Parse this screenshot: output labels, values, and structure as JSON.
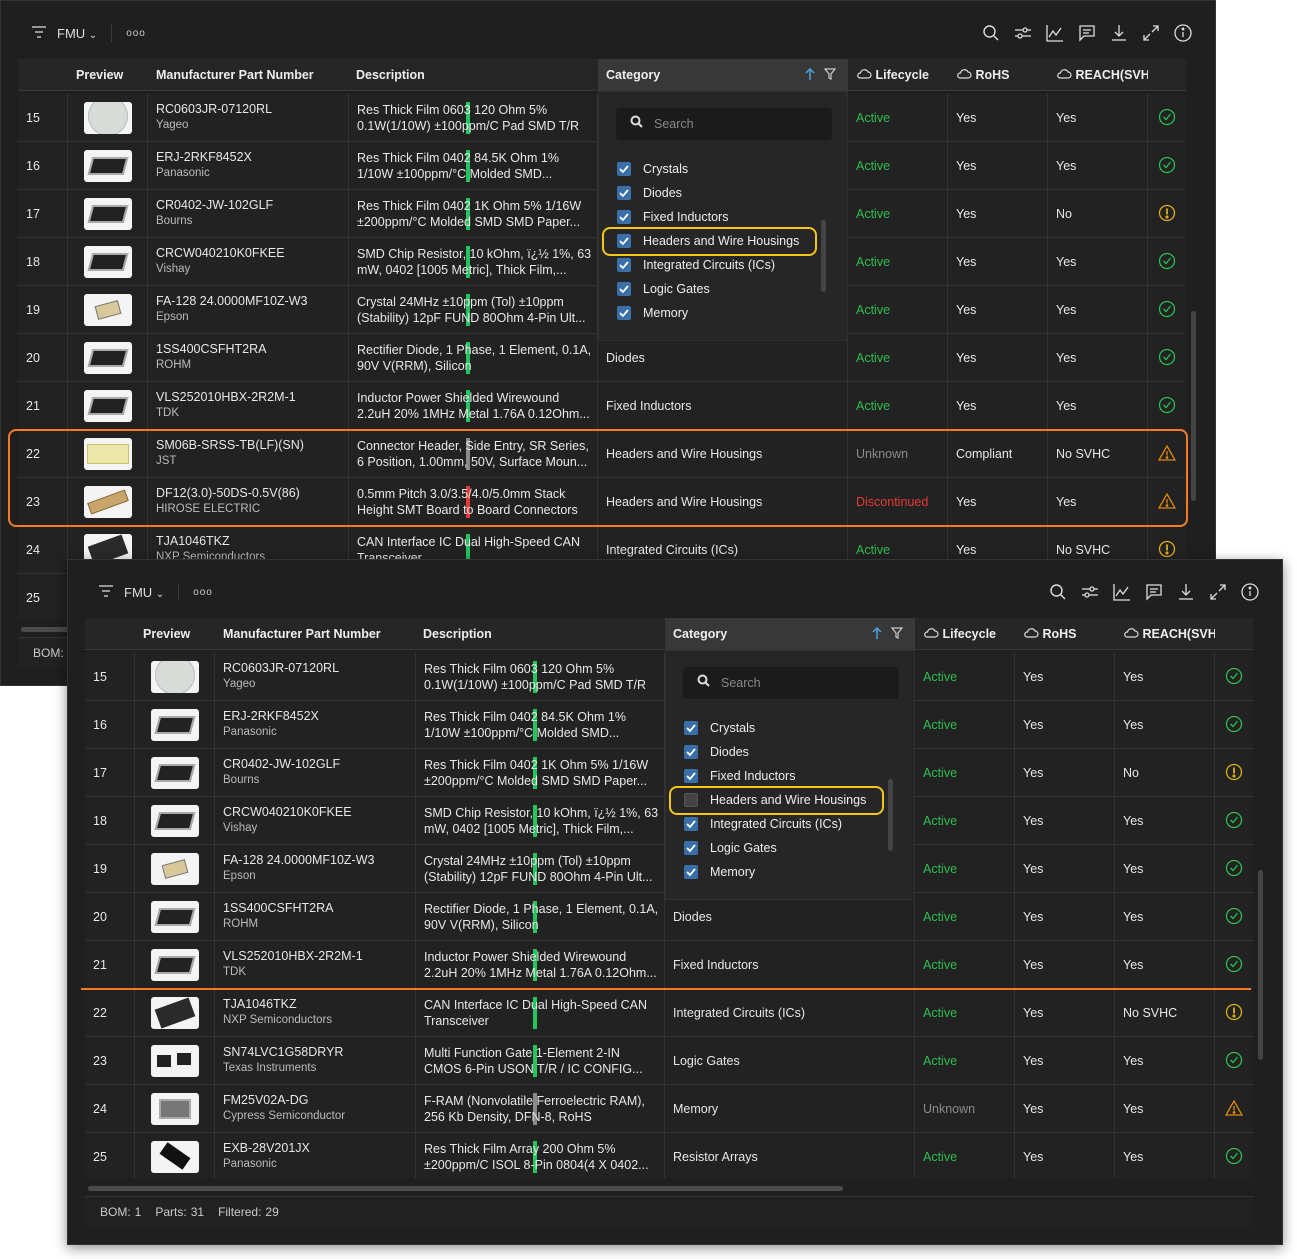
{
  "colors": {
    "active": "#2ebd4e",
    "unknown": "#8a8a8a",
    "discontinued": "#e53935",
    "stripe_green": "#22c55e",
    "stripe_gray": "#8a8a8a",
    "stripe_red": "#e53935",
    "highlight_yellow": "#f5c518",
    "highlight_orange": "#f47b20",
    "checkbox": "#3a6ea8"
  },
  "toolbar": {
    "menu_icon": "filter-lines-icon",
    "project": "FMU",
    "more_icon": "more-dots-icon",
    "more": "ooo",
    "right_icons": [
      "search-icon",
      "sliders-icon",
      "chart-icon",
      "comment-icon",
      "download-icon",
      "expand-icon",
      "info-icon"
    ]
  },
  "columns": {
    "preview": "Preview",
    "mpn": "Manufacturer Part Number",
    "description": "Description",
    "category": "Category",
    "lifecycle": "Lifecycle",
    "rohs": "RoHS",
    "reach": "REACH(SVH"
  },
  "filter": {
    "search_placeholder": "Search",
    "items": [
      "Crystals",
      "Diodes",
      "Fixed Inductors",
      "Headers and Wire Housings",
      "Integrated Circuits (ICs)",
      "Logic Gates",
      "Memory",
      "Resistor Arrays"
    ]
  },
  "windows": [
    {
      "id": "before",
      "filter_checked": [
        true,
        true,
        true,
        true,
        true,
        true,
        true,
        true
      ],
      "status": {
        "bom_label": "BOM:"
      },
      "rows": [
        {
          "num": "15",
          "mpn": "RC0603JR-07120RL",
          "mfr": "Yageo",
          "stripe": "green",
          "thumb": "reel",
          "desc1": "Res Thick Film 0603 120 Ohm 5%",
          "desc2": "0.1W(1/10W) ±100ppm/C Pad SMD T/R",
          "category": "",
          "lifecycle": "Active",
          "rohs": "Yes",
          "reach": "Yes",
          "icon": "check"
        },
        {
          "num": "16",
          "mpn": "ERJ-2RKF8452X",
          "mfr": "Panasonic",
          "stripe": "green",
          "thumb": "chip",
          "desc1": "Res Thick Film 0402 84.5K Ohm 1%",
          "desc2": "1/10W ±100ppm/°C Molded SMD...",
          "category": "",
          "lifecycle": "Active",
          "rohs": "Yes",
          "reach": "Yes",
          "icon": "check"
        },
        {
          "num": "17",
          "mpn": "CR0402-JW-102GLF",
          "mfr": "Bourns",
          "stripe": "green",
          "thumb": "chip",
          "desc1": "Res Thick Film 0402 1K Ohm 5% 1/16W",
          "desc2": "±200ppm/°C Molded SMD SMD Paper...",
          "category": "",
          "lifecycle": "Active",
          "rohs": "Yes",
          "reach": "No",
          "icon": "exclaim"
        },
        {
          "num": "18",
          "mpn": "CRCW040210K0FKEE",
          "mfr": "Vishay",
          "stripe": "green",
          "thumb": "chip",
          "desc1": "SMD Chip Resistor, 10 kOhm, ï¿½ 1%, 63",
          "desc2": "mW, 0402 [1005 Metric], Thick Film,...",
          "category": "",
          "lifecycle": "Active",
          "rohs": "Yes",
          "reach": "Yes",
          "icon": "check"
        },
        {
          "num": "19",
          "mpn": "FA-128 24.0000MF10Z-W3",
          "mfr": "Epson",
          "stripe": "green",
          "thumb": "crystal",
          "desc1": "Crystal 24MHz ±10ppm (Tol) ±10ppm",
          "desc2": "(Stability) 12pF FUND 80Ohm 4-Pin Ult...",
          "category": "",
          "lifecycle": "Active",
          "rohs": "Yes",
          "reach": "Yes",
          "icon": "check"
        },
        {
          "num": "20",
          "mpn": "1SS400CSFHT2RA",
          "mfr": "ROHM",
          "stripe": "green",
          "thumb": "chip",
          "desc1": "Rectifier Diode, 1 Phase, 1 Element, 0.1A,",
          "desc2": "90V V(RRM), Silicon",
          "category": "Diodes",
          "lifecycle": "Active",
          "rohs": "Yes",
          "reach": "Yes",
          "icon": "check"
        },
        {
          "num": "21",
          "mpn": "VLS252010HBX-2R2M-1",
          "mfr": "TDK",
          "stripe": "green",
          "thumb": "chip",
          "desc1": "Inductor Power Shielded Wirewound",
          "desc2": "2.2uH 20% 1MHz Metal 1.76A 0.12Ohm...",
          "category": "Fixed Inductors",
          "lifecycle": "Active",
          "rohs": "Yes",
          "reach": "Yes",
          "icon": "check"
        },
        {
          "num": "22",
          "mpn": "SM06B-SRSS-TB(LF)(SN)",
          "mfr": "JST",
          "stripe": "gray",
          "thumb": "header",
          "desc1": "Connector Header, Side Entry, SR Series,",
          "desc2": "6 Position, 1.00mm, 50V, Surface Moun...",
          "category": "Headers and Wire Housings",
          "lifecycle": "Unknown",
          "rohs": "Compliant",
          "reach": "No SVHC",
          "icon": "warn"
        },
        {
          "num": "23",
          "mpn": "DF12(3.0)-50DS-0.5V(86)",
          "mfr": "HIROSE ELECTRIC",
          "stripe": "red",
          "thumb": "connector",
          "desc1": "0.5mm Pitch 3.0/3.5/4.0/5.0mm Stack",
          "desc2": "Height SMT Board to Board Connectors",
          "category": "Headers and Wire Housings",
          "lifecycle": "Discontinued",
          "rohs": "Yes",
          "reach": "Yes",
          "icon": "warn"
        },
        {
          "num": "24",
          "mpn": "TJA1046TKZ",
          "mfr": "NXP Semiconductors",
          "stripe": "green",
          "thumb": "ic",
          "desc1": "CAN Interface IC Dual High-Speed CAN",
          "desc2": "Transceiver",
          "category": "Integrated Circuits (ICs)",
          "lifecycle": "Active",
          "rohs": "Yes",
          "reach": "No SVHC",
          "icon": "exclaim"
        },
        {
          "num": "25",
          "mpn": "",
          "mfr": "",
          "stripe": "none",
          "thumb": "none",
          "desc1": "",
          "desc2": "",
          "category": "",
          "lifecycle": "",
          "rohs": "",
          "reach": "",
          "icon": "none"
        }
      ]
    },
    {
      "id": "after",
      "filter_checked": [
        true,
        true,
        true,
        false,
        true,
        true,
        true,
        true
      ],
      "status": {
        "bom_label": "BOM:",
        "bom": "1",
        "parts_label": "Parts:",
        "parts": "31",
        "filtered_label": "Filtered:",
        "filtered": "29"
      },
      "rows": [
        {
          "num": "15",
          "mpn": "RC0603JR-07120RL",
          "mfr": "Yageo",
          "stripe": "green",
          "thumb": "reel",
          "desc1": "Res Thick Film 0603 120 Ohm 5%",
          "desc2": "0.1W(1/10W) ±100ppm/C Pad SMD T/R",
          "category": "",
          "lifecycle": "Active",
          "rohs": "Yes",
          "reach": "Yes",
          "icon": "check"
        },
        {
          "num": "16",
          "mpn": "ERJ-2RKF8452X",
          "mfr": "Panasonic",
          "stripe": "green",
          "thumb": "chip",
          "desc1": "Res Thick Film 0402 84.5K Ohm 1%",
          "desc2": "1/10W ±100ppm/°C Molded SMD...",
          "category": "",
          "lifecycle": "Active",
          "rohs": "Yes",
          "reach": "Yes",
          "icon": "check"
        },
        {
          "num": "17",
          "mpn": "CR0402-JW-102GLF",
          "mfr": "Bourns",
          "stripe": "green",
          "thumb": "chip",
          "desc1": "Res Thick Film 0402 1K Ohm 5% 1/16W",
          "desc2": "±200ppm/°C Molded SMD SMD Paper...",
          "category": "",
          "lifecycle": "Active",
          "rohs": "Yes",
          "reach": "No",
          "icon": "exclaim"
        },
        {
          "num": "18",
          "mpn": "CRCW040210K0FKEE",
          "mfr": "Vishay",
          "stripe": "green",
          "thumb": "chip",
          "desc1": "SMD Chip Resistor, 10 kOhm, ï¿½ 1%, 63",
          "desc2": "mW, 0402 [1005 Metric], Thick Film,...",
          "category": "",
          "lifecycle": "Active",
          "rohs": "Yes",
          "reach": "Yes",
          "icon": "check"
        },
        {
          "num": "19",
          "mpn": "FA-128 24.0000MF10Z-W3",
          "mfr": "Epson",
          "stripe": "green",
          "thumb": "crystal",
          "desc1": "Crystal 24MHz ±10ppm (Tol) ±10ppm",
          "desc2": "(Stability) 12pF FUND 80Ohm 4-Pin Ult...",
          "category": "",
          "lifecycle": "Active",
          "rohs": "Yes",
          "reach": "Yes",
          "icon": "check"
        },
        {
          "num": "20",
          "mpn": "1SS400CSFHT2RA",
          "mfr": "ROHM",
          "stripe": "green",
          "thumb": "chip",
          "desc1": "Rectifier Diode, 1 Phase, 1 Element, 0.1A,",
          "desc2": "90V V(RRM), Silicon",
          "category": "Diodes",
          "lifecycle": "Active",
          "rohs": "Yes",
          "reach": "Yes",
          "icon": "check"
        },
        {
          "num": "21",
          "mpn": "VLS252010HBX-2R2M-1",
          "mfr": "TDK",
          "stripe": "green",
          "thumb": "chip",
          "desc1": "Inductor Power Shielded Wirewound",
          "desc2": "2.2uH 20% 1MHz Metal 1.76A 0.12Ohm...",
          "category": "Fixed Inductors",
          "lifecycle": "Active",
          "rohs": "Yes",
          "reach": "Yes",
          "icon": "check"
        },
        {
          "num": "22",
          "mpn": "TJA1046TKZ",
          "mfr": "NXP Semiconductors",
          "stripe": "green",
          "thumb": "ic",
          "desc1": "CAN Interface IC Dual High-Speed CAN",
          "desc2": "Transceiver",
          "category": "Integrated Circuits (ICs)",
          "lifecycle": "Active",
          "rohs": "Yes",
          "reach": "No SVHC",
          "icon": "exclaim"
        },
        {
          "num": "23",
          "mpn": "SN74LVC1G58DRYR",
          "mfr": "Texas Instruments",
          "stripe": "green",
          "thumb": "sot",
          "desc1": "Multi Function Gate 1-Element 2-IN",
          "desc2": "CMOS 6-Pin USON T/R / IC CONFIG...",
          "category": "Logic Gates",
          "lifecycle": "Active",
          "rohs": "Yes",
          "reach": "Yes",
          "icon": "check"
        },
        {
          "num": "24",
          "mpn": "FM25V02A-DG",
          "mfr": "Cypress Semiconductor",
          "stripe": "gray",
          "thumb": "dfn",
          "desc1": "F-RAM (Nonvolatile Ferroelectric RAM),",
          "desc2": "256 Kb Density, DFN-8, RoHS",
          "category": "Memory",
          "lifecycle": "Unknown",
          "rohs": "Yes",
          "reach": "Yes",
          "icon": "warn"
        },
        {
          "num": "25",
          "mpn": "EXB-28V201JX",
          "mfr": "Panasonic",
          "stripe": "green",
          "thumb": "array",
          "desc1": "Res Thick Film Array 200 Ohm 5%",
          "desc2": "±200ppm/C ISOL 8-Pin 0804(4 X 0402...",
          "category": "Resistor Arrays",
          "lifecycle": "Active",
          "rohs": "Yes",
          "reach": "Yes",
          "icon": "check"
        }
      ]
    }
  ]
}
